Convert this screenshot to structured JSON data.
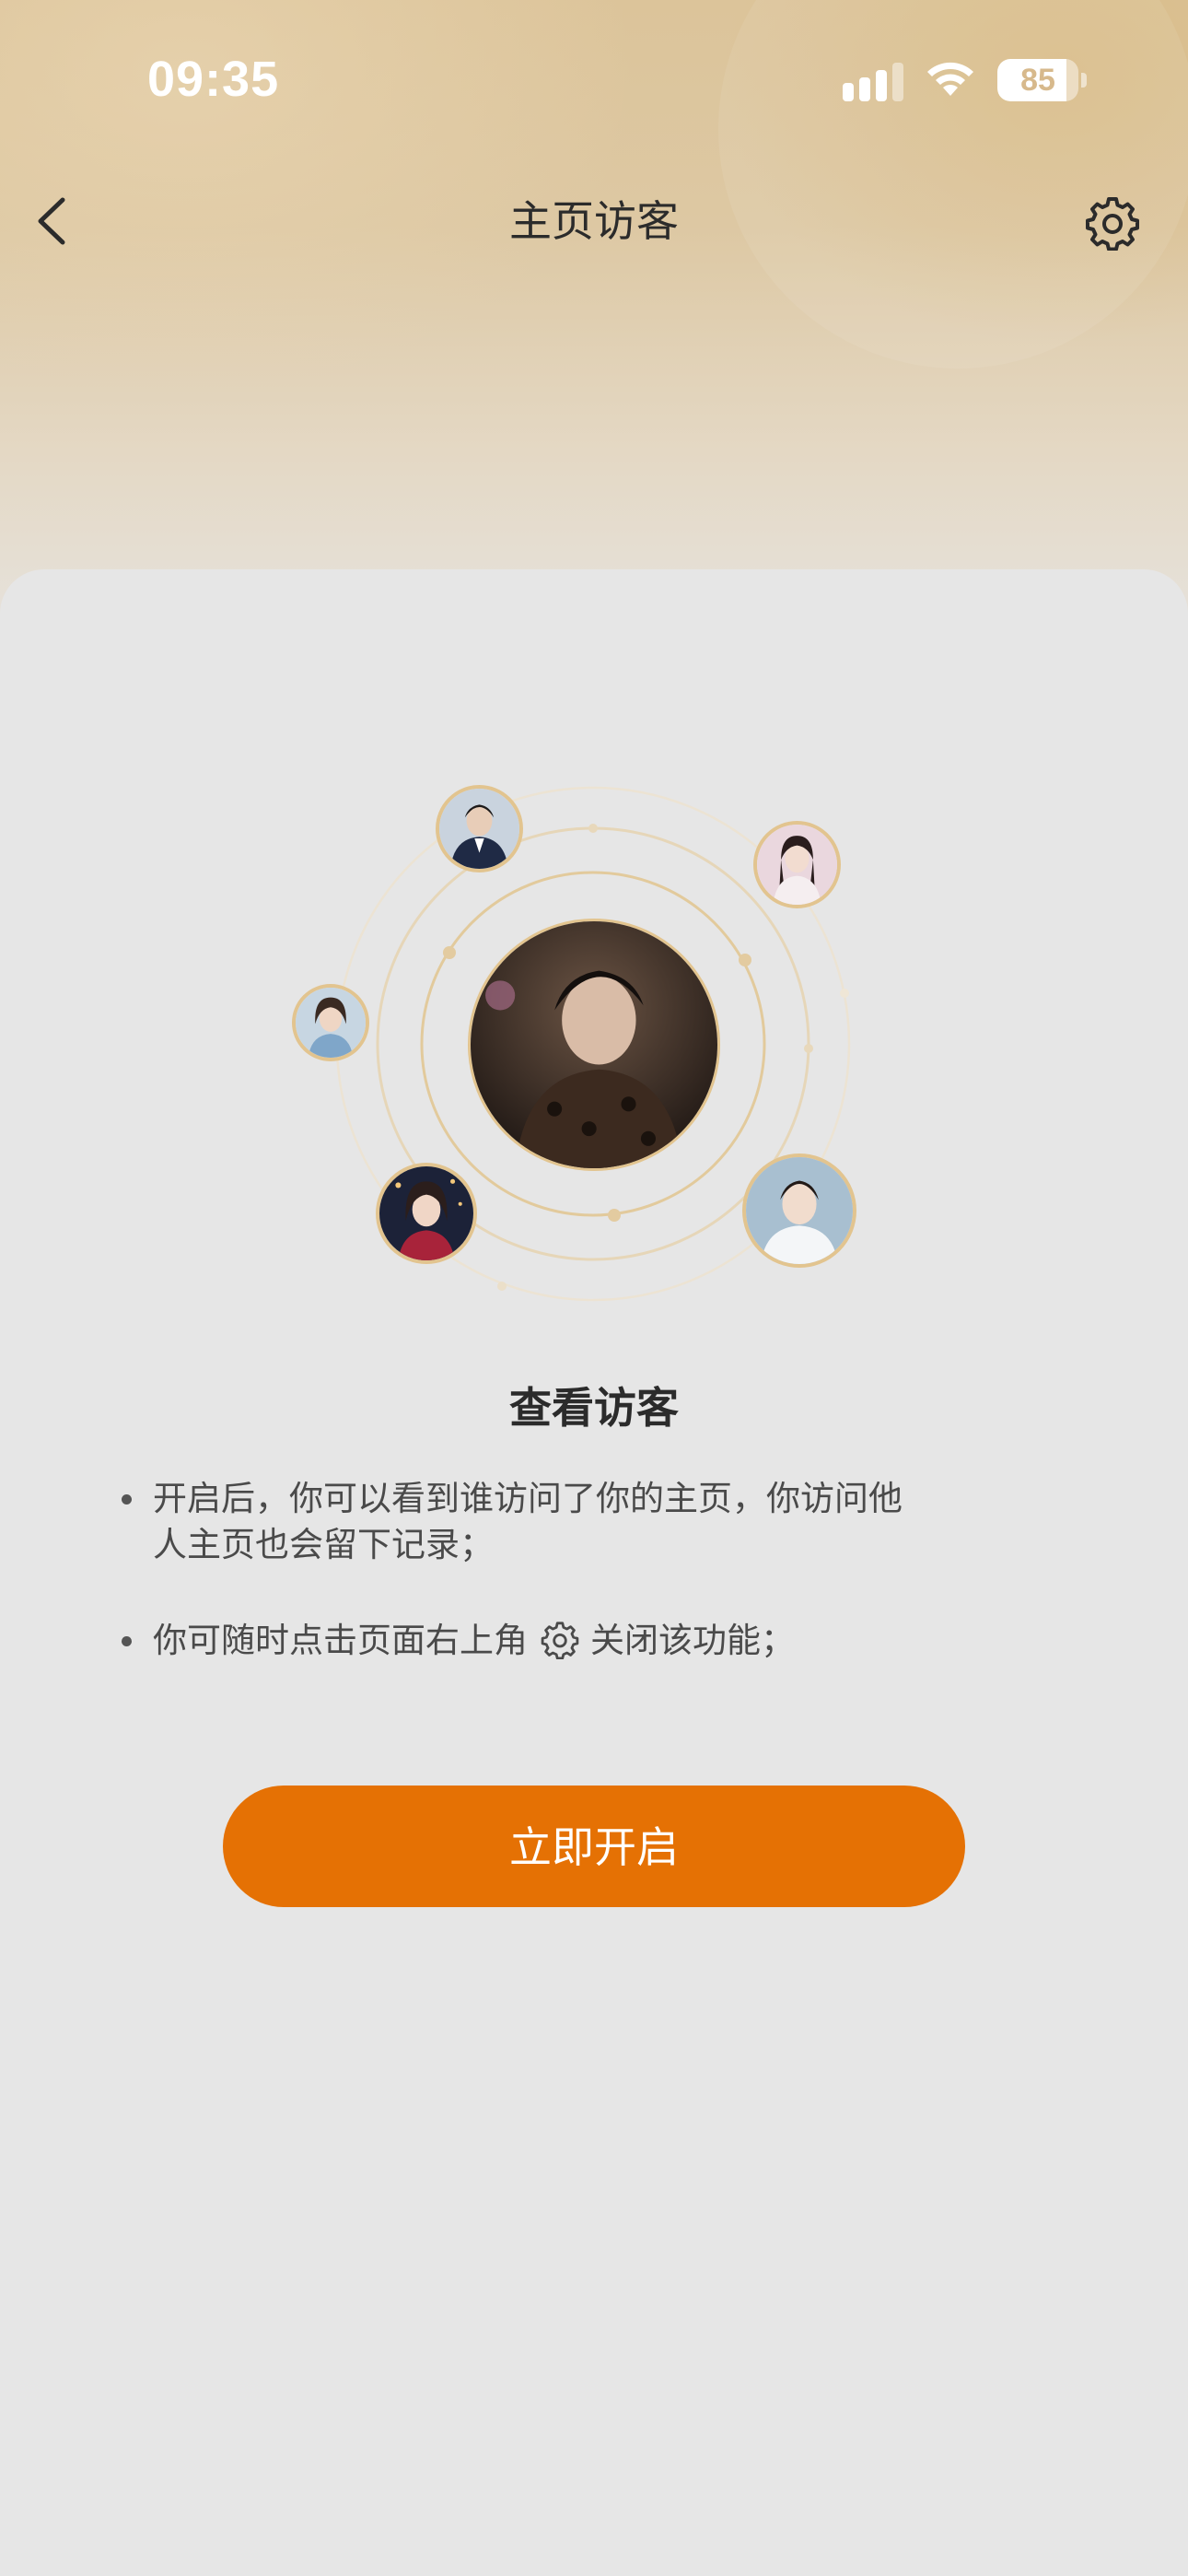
{
  "status_bar": {
    "time": "09:35",
    "battery_level": "85",
    "battery_fraction": 0.85
  },
  "nav": {
    "title": "主页访客",
    "back_icon": "chevron-left-icon",
    "settings_icon": "gear-icon"
  },
  "feature": {
    "title": "查看访客",
    "tips": [
      {
        "text": "开启后，你可以看到谁访问了你的主页，你访问他人主页也会留下记录；"
      },
      {
        "before": "你可随时点击页面右上角",
        "icon": "gear-icon",
        "after": "关闭该功能；"
      }
    ]
  },
  "cta": {
    "label": "立即开启"
  },
  "colors": {
    "accent": "#e57104",
    "avatar_ring": "#e2c48f",
    "orbit_line": "#e6d2ad"
  }
}
